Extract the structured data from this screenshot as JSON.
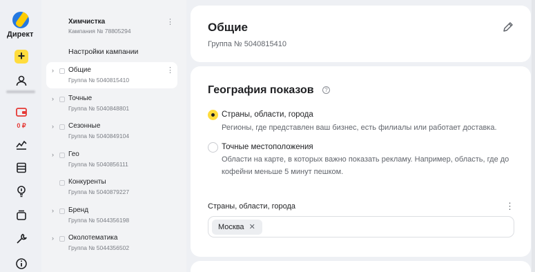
{
  "rail": {
    "logo_label": "Директ",
    "balance": "0 ₽",
    "icons": [
      "plus-icon",
      "user-icon",
      "wallet-icon",
      "chart-icon",
      "list-icon",
      "lightbulb-icon",
      "stack-icon",
      "wrench-icon",
      "info-icon"
    ]
  },
  "tree": {
    "campaign": {
      "name": "Химчистка",
      "number": "Кампания № 78805294"
    },
    "settings_label": "Настройки кампании",
    "groups": [
      {
        "name": "Общие",
        "number": "Группа № 5040815410"
      },
      {
        "name": "Точные",
        "number": "Группа № 5040848801"
      },
      {
        "name": "Сезонные",
        "number": "Группа № 5040849104"
      },
      {
        "name": "Гео",
        "number": "Группа № 5040856111"
      },
      {
        "name": "Конкуренты",
        "number": "Группа № 5040879227"
      },
      {
        "name": "Бренд",
        "number": "Группа № 5044356198"
      },
      {
        "name": "Околотематика",
        "number": "Группа № 5044356502"
      }
    ]
  },
  "header": {
    "title": "Общие",
    "subtitle": "Группа № 5040815410"
  },
  "geo": {
    "title": "География показов",
    "options": [
      {
        "label": "Страны, области, города",
        "desc": "Регионы, где представлен ваш бизнес, есть филиалы или работает доставка.",
        "selected": true
      },
      {
        "label": "Точные местоположения",
        "desc": "Области на карте, в которых важно показать рекламу. Например, область, где до кофейни меньше 5 минут пешком.",
        "selected": false
      }
    ],
    "field_label": "Страны, области, города",
    "tags": [
      "Москва"
    ]
  },
  "colors": {
    "accent": "#ffdc3d",
    "brand_blue": "#2679e0",
    "balance_red": "#e53935"
  }
}
